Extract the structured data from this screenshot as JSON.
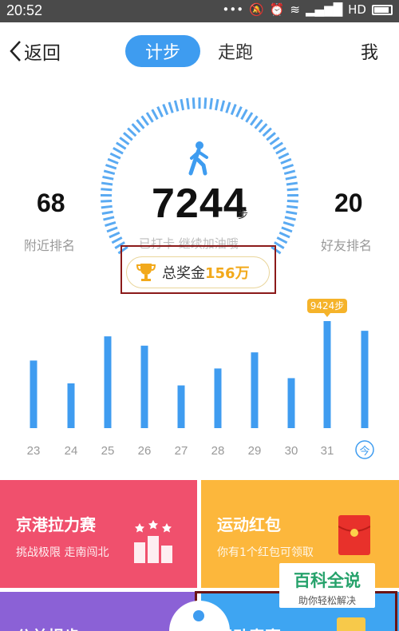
{
  "status": {
    "time": "20:52",
    "network": "HD"
  },
  "header": {
    "back_label": "返回",
    "tab_active": "计步",
    "tab_other": "走跑",
    "me_label": "我"
  },
  "stats": {
    "steps": "7244",
    "steps_unit": "步",
    "checkin_text": "已打卡  继续加油哦",
    "nearby_rank": "68",
    "nearby_label": "附近排名",
    "friend_rank": "20",
    "friend_label": "好友排名"
  },
  "prize": {
    "label": "总奖金",
    "amount": "156万"
  },
  "chart_data": {
    "type": "bar",
    "categories": [
      "23",
      "24",
      "25",
      "26",
      "27",
      "28",
      "29",
      "30",
      "31",
      "今"
    ],
    "values": [
      5950,
      3940,
      8080,
      7260,
      3760,
      5250,
      6670,
      4400,
      9424,
      8570
    ],
    "highlight_label": "9424步",
    "highlight_index": 8,
    "color": "#3f9cf0"
  },
  "cards": [
    {
      "title": "京港拉力赛",
      "subtitle": "挑战极限 走南闯北",
      "color": "#f0506d"
    },
    {
      "title": "运动红包",
      "subtitle": "你有1个红包可领取",
      "color": "#fcb73c"
    },
    {
      "title": "公益捐步",
      "color": "#8b61d6"
    },
    {
      "title": "运动竞赛",
      "color": "#3ea5f2"
    }
  ],
  "watermark": {
    "title": "百科全说",
    "subtitle": "助你轻松解决"
  }
}
